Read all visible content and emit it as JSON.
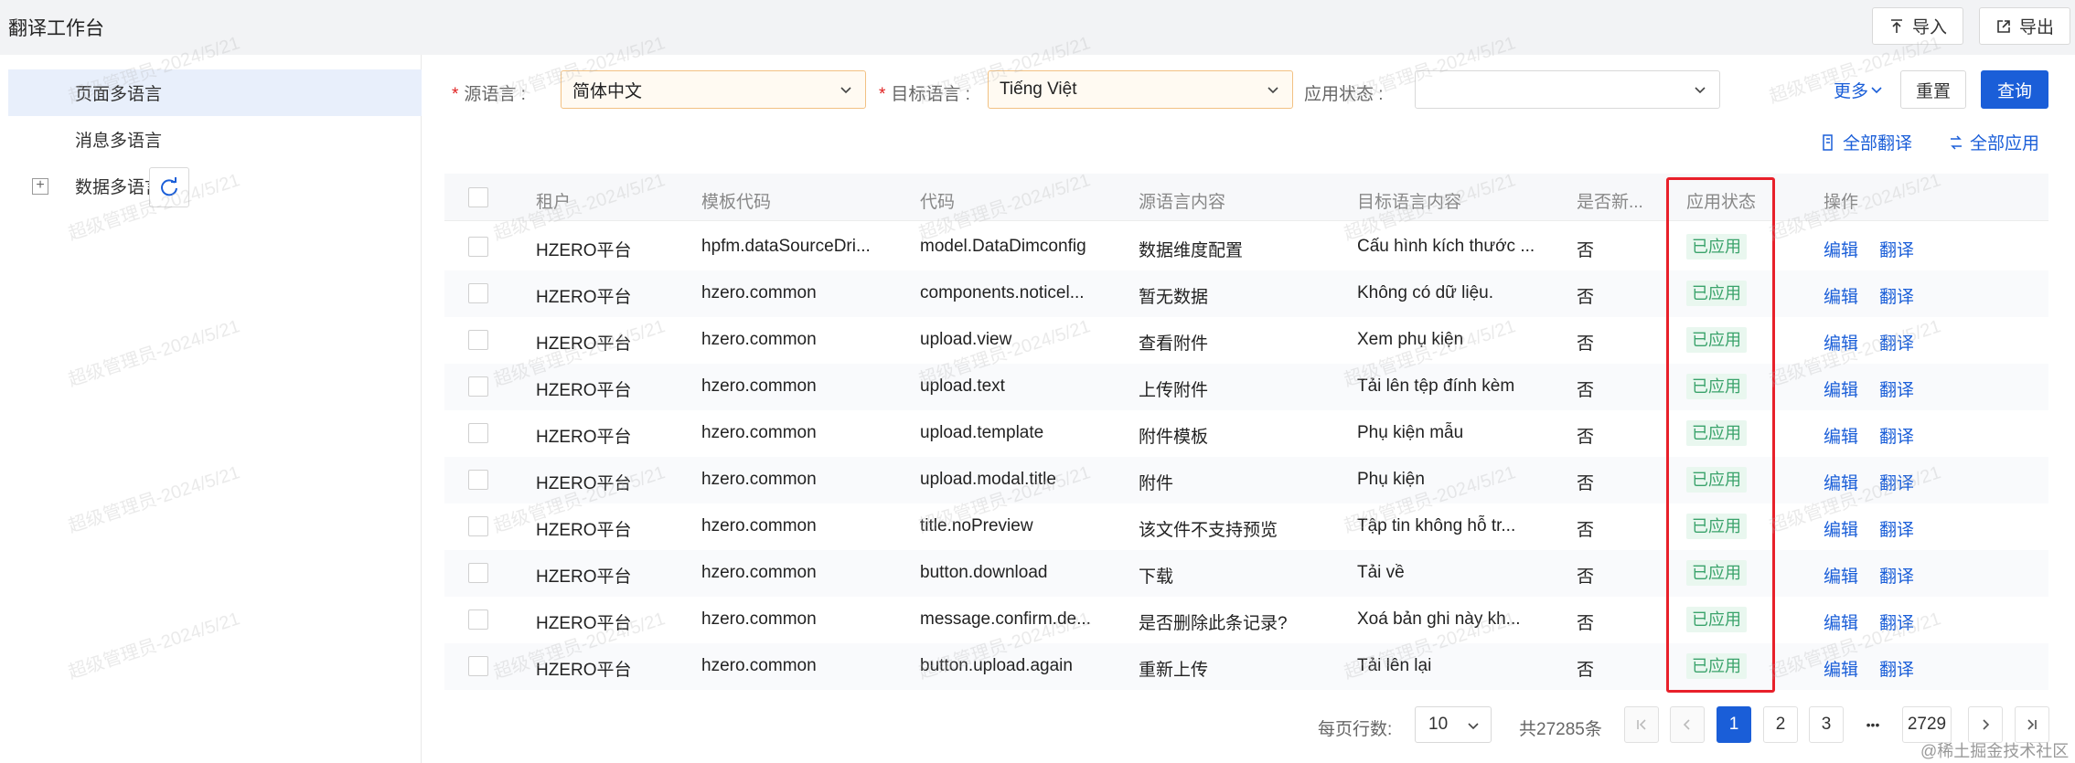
{
  "header": {
    "title": "翻译工作台",
    "import_label": "导入",
    "export_label": "导出"
  },
  "sidebar": {
    "items": [
      {
        "label": "页面多语言",
        "active": true
      },
      {
        "label": "消息多语言",
        "active": false
      },
      {
        "label": "数据多语言",
        "active": false
      }
    ]
  },
  "filters": {
    "source_lang_label": "源语言 :",
    "source_lang_value": "简体中文",
    "target_lang_label": "目标语言 :",
    "target_lang_value": "Tiếng Việt",
    "status_label": "应用状态 :",
    "status_value": "",
    "more_label": "更多",
    "reset_label": "重置",
    "query_label": "查询"
  },
  "actions": {
    "translate_all": "全部翻译",
    "apply_all": "全部应用"
  },
  "table": {
    "columns": [
      "租户",
      "模板代码",
      "代码",
      "源语言内容",
      "目标语言内容",
      "是否新...",
      "应用状态",
      "操作"
    ],
    "rows": [
      {
        "tenant": "HZERO平台",
        "template": "hpfm.dataSourceDri...",
        "code": "model.DataDimconfig",
        "source": "数据维度配置",
        "target": "Cấu hình kích thước ...",
        "is_new": "否",
        "status": "已应用"
      },
      {
        "tenant": "HZERO平台",
        "template": "hzero.common",
        "code": "components.noticel...",
        "source": "暂无数据",
        "target": "Không có dữ liệu.",
        "is_new": "否",
        "status": "已应用"
      },
      {
        "tenant": "HZERO平台",
        "template": "hzero.common",
        "code": "upload.view",
        "source": "查看附件",
        "target": "Xem phụ kiện",
        "is_new": "否",
        "status": "已应用"
      },
      {
        "tenant": "HZERO平台",
        "template": "hzero.common",
        "code": "upload.text",
        "source": "上传附件",
        "target": "Tải lên tệp đính kèm",
        "is_new": "否",
        "status": "已应用"
      },
      {
        "tenant": "HZERO平台",
        "template": "hzero.common",
        "code": "upload.template",
        "source": "附件模板",
        "target": "Phụ kiện mẫu",
        "is_new": "否",
        "status": "已应用"
      },
      {
        "tenant": "HZERO平台",
        "template": "hzero.common",
        "code": "upload.modal.title",
        "source": "附件",
        "target": "Phụ kiện",
        "is_new": "否",
        "status": "已应用"
      },
      {
        "tenant": "HZERO平台",
        "template": "hzero.common",
        "code": "title.noPreview",
        "source": "该文件不支持预览",
        "target": "Tập tin không hỗ tr...",
        "is_new": "否",
        "status": "已应用"
      },
      {
        "tenant": "HZERO平台",
        "template": "hzero.common",
        "code": "button.download",
        "source": "下载",
        "target": "Tải về",
        "is_new": "否",
        "status": "已应用"
      },
      {
        "tenant": "HZERO平台",
        "template": "hzero.common",
        "code": "message.confirm.de...",
        "source": "是否删除此条记录?",
        "target": "Xoá bản ghi này kh...",
        "is_new": "否",
        "status": "已应用"
      },
      {
        "tenant": "HZERO平台",
        "template": "hzero.common",
        "code": "button.upload.again",
        "source": "重新上传",
        "target": "Tải lên lại",
        "is_new": "否",
        "status": "已应用"
      }
    ],
    "op_edit": "编辑",
    "op_translate": "翻译"
  },
  "pagination": {
    "page_size_label": "每页行数:",
    "page_size": "10",
    "total": "共27285条",
    "pages": [
      "1",
      "2",
      "3"
    ],
    "ellipsis": "•••",
    "last_page": "2729"
  },
  "watermark": "超级管理员-2024/5/21",
  "source_mark": "@稀土掘金技术社区",
  "colors": {
    "primary": "#1a5ed8",
    "highlight_box": "#e8202a",
    "status_green": "#3aa36b"
  }
}
